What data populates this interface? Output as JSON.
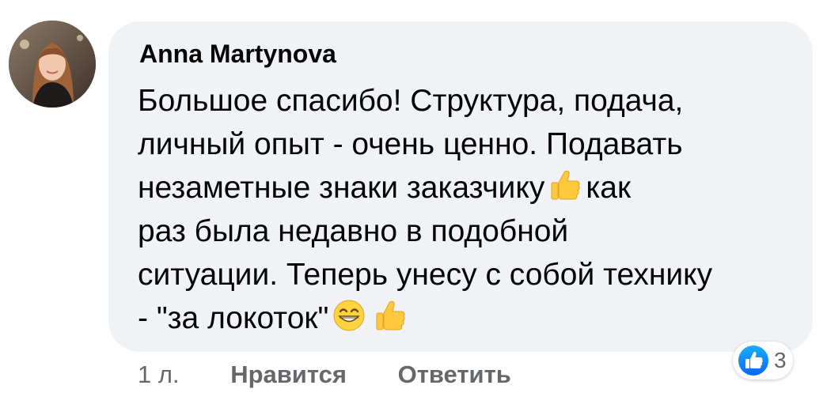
{
  "comment": {
    "author": "Anna Martynova",
    "lines": [
      "Большое спасибо! Структура, подача,",
      "личный опыт - очень ценно. Подавать",
      "незаметные знаки заказчику",
      "как",
      "раз была недавно в подобной",
      "ситуации. Теперь унесу с собой технику",
      "- \"за локоток\""
    ],
    "emojis": {
      "line3": "thumbs-up-icon",
      "line7": [
        "grinning-face-icon",
        "thumbs-up-icon"
      ]
    }
  },
  "actions": {
    "time": "1 л.",
    "like_label": "Нравится",
    "reply_label": "Ответить"
  },
  "reactions": {
    "icon": "like-reaction-icon",
    "count": "3",
    "color": "#1877f2"
  },
  "colors": {
    "bubble": "#f0f2f5",
    "text": "#050505",
    "secondary": "#65676b",
    "emoji_yellow": "#ffc83d"
  }
}
